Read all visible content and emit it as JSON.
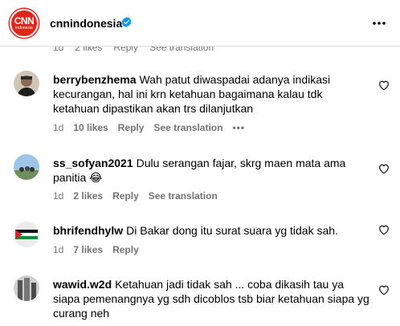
{
  "header": {
    "logo_main": "CNN",
    "logo_sub": "indonesia",
    "account_name": "cnnindonesia"
  },
  "ghost_row": [
    "1d",
    "2 likes",
    "Reply",
    "See translation"
  ],
  "comments": [
    {
      "username": "berrybenzhema",
      "text": "Wah patut diwaspadai adanya indikasi kecurangan, hal ini krn ketahuan bagaimana kalau tdk ketahuan dipastikan akan trs dilanjutkan",
      "time": "1d",
      "likes": "10 likes",
      "reply": "Reply",
      "translate": "See translation",
      "more": "•••"
    },
    {
      "username": "ss_sofyan2021",
      "text": "Dulu serangan fajar, skrg maen mata ama panitia 😂",
      "time": "1d",
      "likes": "2 likes",
      "reply": "Reply",
      "translate": "See translation"
    },
    {
      "username": "bhrifendhylw",
      "text": "Di Bakar dong itu surat suara yg tidak sah.",
      "time": "1d",
      "likes": "7 likes",
      "reply": "Reply"
    },
    {
      "username": "wawid.w2d",
      "text": "Ketahuan jadi tidak sah ... coba dikasih tau ya siapa pemenangnya yg sdh dicoblos tsb biar ketahuan siapa yg curang neh"
    }
  ],
  "colors": {
    "brand_red": "#e0261b",
    "verified_blue": "#0095f6",
    "meta_gray": "#737373"
  }
}
